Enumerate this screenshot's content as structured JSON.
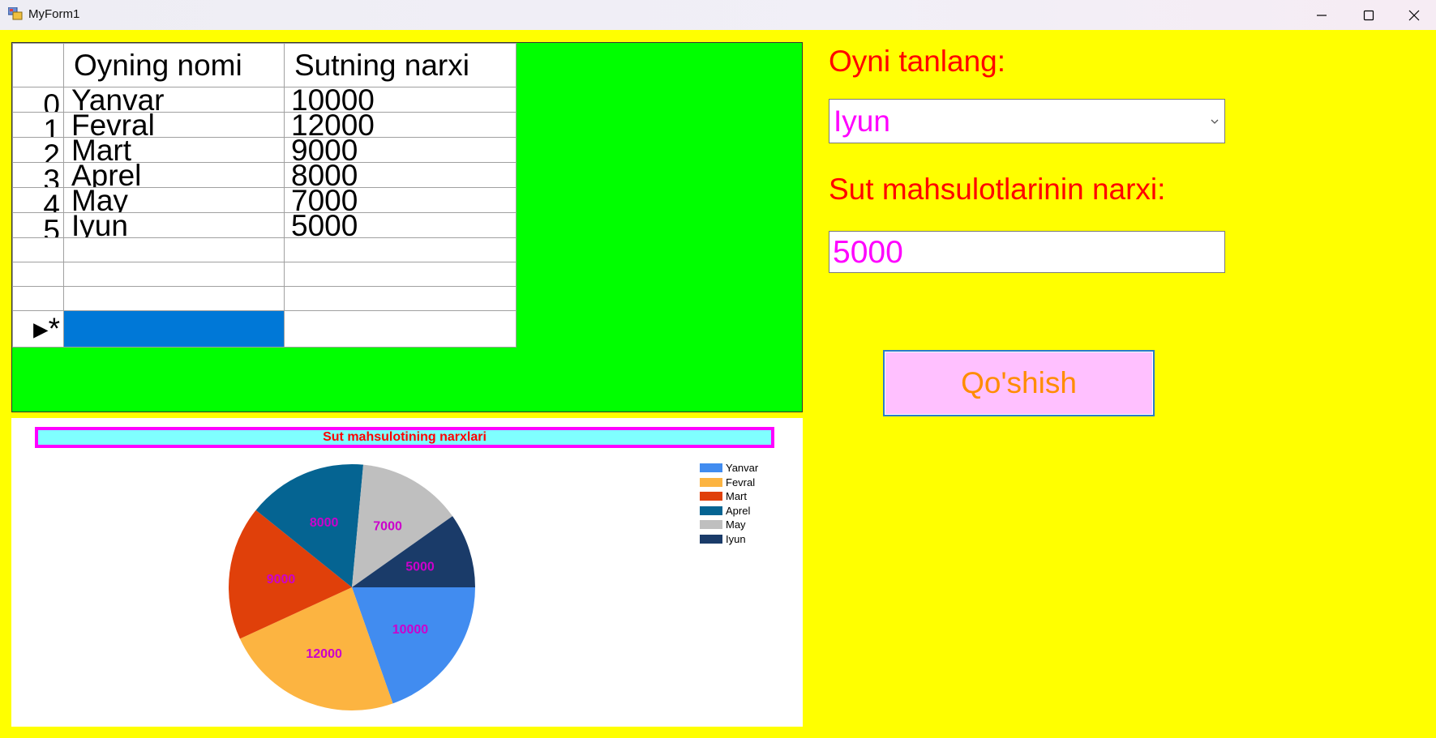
{
  "window": {
    "title": "MyForm1"
  },
  "grid": {
    "columns": [
      "Oyning nomi",
      "Sutning narxi"
    ],
    "rows": [
      {
        "index": "0",
        "month": "Yanvar",
        "price": "10000"
      },
      {
        "index": "1",
        "month": "Fevral",
        "price": "12000"
      },
      {
        "index": "2",
        "month": "Mart",
        "price": "9000"
      },
      {
        "index": "3",
        "month": "Aprel",
        "price": "8000"
      },
      {
        "index": "4",
        "month": "May",
        "price": "7000"
      },
      {
        "index": "5",
        "month": "Iyun",
        "price": "5000"
      }
    ],
    "new_row_marker": "▸*"
  },
  "form": {
    "select_label": "Oyni tanlang:",
    "selected_month": "Iyun",
    "price_label": "Sut mahsulotlarinin narxi:",
    "price_value": "5000",
    "add_button": "Qo'shish"
  },
  "colors": {
    "form_background": "#ffff00",
    "grid_background": "#00ff00",
    "label_red": "#ff0000",
    "value_magenta": "#ff00ff",
    "button_background": "#ffc0ff",
    "button_text": "#ff8c00"
  },
  "chart_data": {
    "type": "pie",
    "title": "Sut mahsulotining narxlari",
    "legend_position": "top-right",
    "label_color": "#cc00cc",
    "slices": [
      {
        "label": "Yanvar",
        "value": 10000,
        "color": "#418cf0"
      },
      {
        "label": "Fevral",
        "value": 12000,
        "color": "#fcb441"
      },
      {
        "label": "Mart",
        "value": 9000,
        "color": "#e0400a"
      },
      {
        "label": "Aprel",
        "value": 8000,
        "color": "#056492"
      },
      {
        "label": "May",
        "value": 7000,
        "color": "#bfbfbf"
      },
      {
        "label": "Iyun",
        "value": 5000,
        "color": "#1a3b69"
      }
    ]
  }
}
